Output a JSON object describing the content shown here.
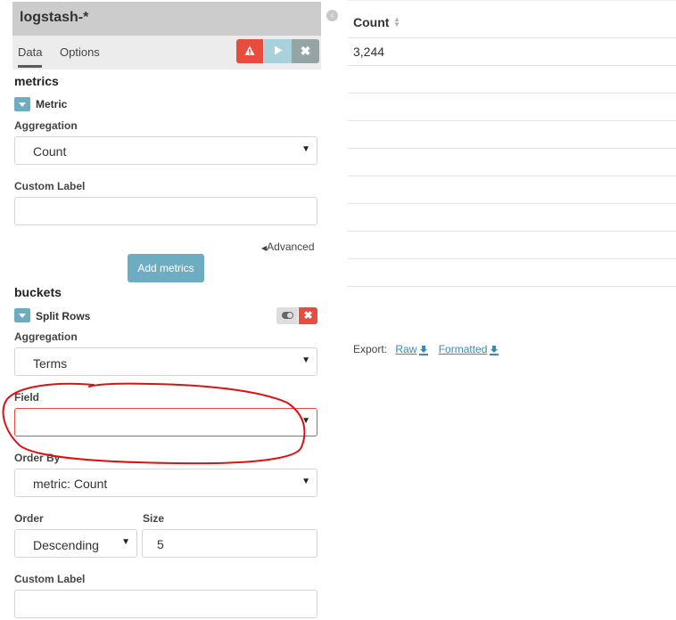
{
  "sidebar": {
    "index_pattern": "logstash-*",
    "tabs": [
      {
        "label": "Data"
      },
      {
        "label": "Options"
      }
    ],
    "toolbar": {
      "warn_icon": "warning-icon",
      "play_icon": "play-icon",
      "close_icon": "close-icon"
    },
    "metrics": {
      "title": "metrics",
      "metric_label": "Metric",
      "aggregation_label": "Aggregation",
      "aggregation_value": "Count",
      "custom_label_label": "Custom Label",
      "custom_label_value": "",
      "advanced_label": "Advanced",
      "add_metrics_label": "Add metrics"
    },
    "buckets": {
      "title": "buckets",
      "split_label": "Split Rows",
      "aggregation_label": "Aggregation",
      "aggregation_value": "Terms",
      "field_label": "Field",
      "field_value": "",
      "order_by_label": "Order By",
      "order_by_value": "metric: Count",
      "order_label": "Order",
      "order_value": "Descending",
      "size_label": "Size",
      "size_value": "5",
      "custom_label_label": "Custom Label",
      "custom_label_value": ""
    }
  },
  "table": {
    "column_header": "Count",
    "rows": [
      "3,244"
    ]
  },
  "export": {
    "label": "Export:",
    "raw": "Raw",
    "formatted": "Formatted"
  },
  "colors": {
    "accent": "#6eadc1",
    "danger": "#e74c3c",
    "link": "#3a8ab3",
    "annotation": "#dd1111"
  }
}
